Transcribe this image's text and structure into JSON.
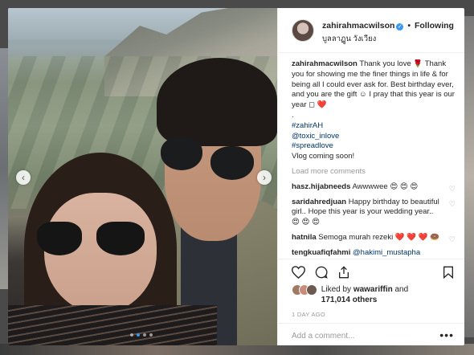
{
  "header": {
    "username": "zahirahmacwilson",
    "separator": "•",
    "follow_status": "Following",
    "location": "บูลลาฏูน วังเวียง"
  },
  "caption": {
    "username": "zahirahmacwilson",
    "lines": [
      "Thank you love 🌹",
      "Thank you for showing me the finer things in life & for being all I could ever ask for. Best birthday ever, and you are the gift ☺ I pray that this year is our year ◻",
      "."
    ],
    "heart": "❤️",
    "hashtags": [
      "#zahirAH",
      "@toxic_inlove",
      "#spreadlove"
    ],
    "closing": "Vlog coming soon!"
  },
  "load_more": "Load more comments",
  "comments": [
    {
      "user": "hasz.hijabneeds",
      "text": "Awwwwee 😍 😍 😍"
    },
    {
      "user": "saridahredjuan",
      "text": "Happy birthday to beautiful girl.. Hope this year is your wedding year.. 😍 😍 😍"
    },
    {
      "user": "hatnila",
      "text": "Semoga murah rezeki ❤️ ❤️ ❤️ 🍩"
    },
    {
      "user": "tengkuafiqfahmi",
      "text": "@hakimi_mustapha"
    }
  ],
  "actions": {
    "like_icon": "heart-icon",
    "comment_icon": "comment-icon",
    "share_icon": "share-icon",
    "save_icon": "bookmark-icon"
  },
  "likes": {
    "prefix": "Liked by",
    "user": "wawariffin",
    "and": "and",
    "count": "171,014 others"
  },
  "timestamp": "1 DAY AGO",
  "add_comment_placeholder": "Add a comment...",
  "more_options": "•••",
  "carousel": {
    "total": 4,
    "active": 1
  }
}
